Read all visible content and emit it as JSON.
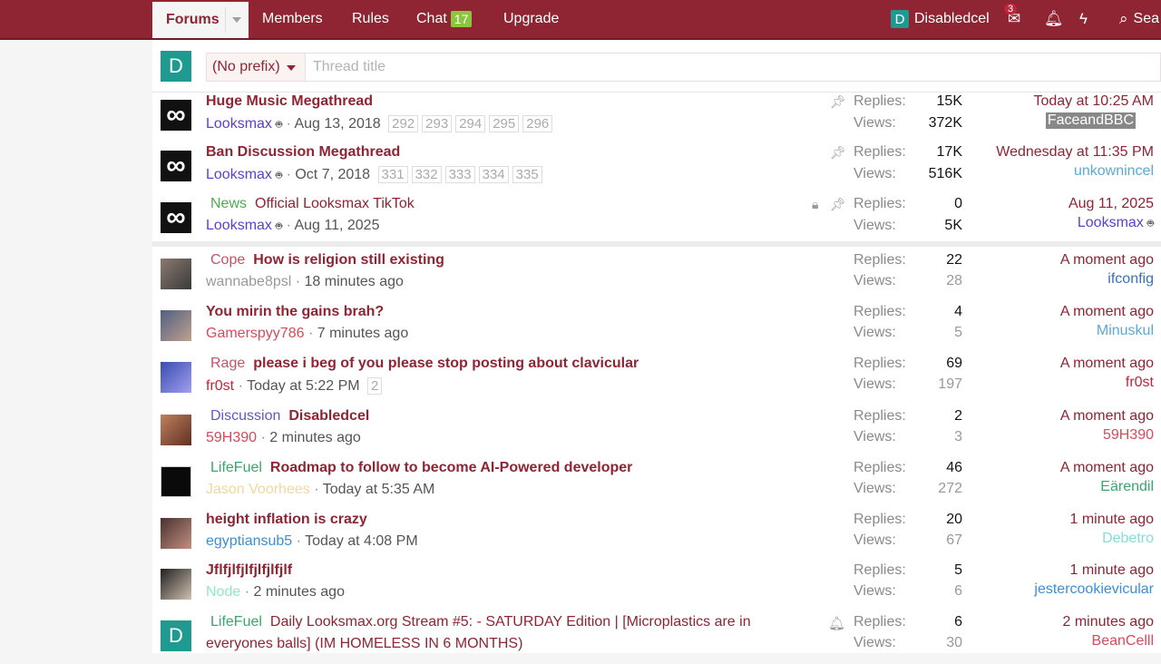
{
  "nav": {
    "forums": "Forums",
    "members": "Members",
    "rules": "Rules",
    "chat": "Chat",
    "chat_count": "17",
    "upgrade": "Upgrade",
    "user_initial": "D",
    "username": "Disabledcel",
    "inbox_count": "3",
    "search": "Sea"
  },
  "composer": {
    "avatar_initial": "D",
    "prefix": "(No prefix)",
    "title_placeholder": "Thread title"
  },
  "sticky_threads": [
    {
      "prefix": "",
      "title": "Huge Music Megathread",
      "author": "Looksmax",
      "date": "Aug 13, 2018",
      "pages": [
        "292",
        "293",
        "294",
        "295",
        "296"
      ],
      "replies_label": "Replies:",
      "replies": "15K",
      "views_label": "Views:",
      "views": "372K",
      "last_time": "Today at 10:25 AM",
      "last_user": "FaceandBBC"
    },
    {
      "prefix": "",
      "title": "Ban Discussion Megathread",
      "author": "Looksmax",
      "date": "Oct 7, 2018",
      "pages": [
        "331",
        "332",
        "333",
        "334",
        "335"
      ],
      "replies_label": "Replies:",
      "replies": "17K",
      "views_label": "Views:",
      "views": "516K",
      "last_time": "Wednesday at 11:35 PM",
      "last_user": "unkownincel"
    },
    {
      "prefix": "News",
      "title": "Official Looksmax TikTok",
      "author": "Looksmax",
      "date": "Aug 11, 2025",
      "pages": [],
      "replies_label": "Replies:",
      "replies": "0",
      "views_label": "Views:",
      "views": "5K",
      "last_time": "Aug 11, 2025",
      "last_user": "Looksmax"
    }
  ],
  "threads": [
    {
      "prefix": "Cope",
      "title": "How is religion still existing",
      "author": "wannabe8psl",
      "date": "18 minutes ago",
      "pages": [],
      "replies": "22",
      "views": "28",
      "last_time": "A moment ago",
      "last_user": "ifconfig"
    },
    {
      "prefix": "",
      "title": "You mirin the gains brah?",
      "author": "Gamerspyy786",
      "date": "7 minutes ago",
      "pages": [],
      "replies": "4",
      "views": "5",
      "last_time": "A moment ago",
      "last_user": "Minuskul"
    },
    {
      "prefix": "Rage",
      "title": "please i beg of you please stop posting about clavicular",
      "author": "fr0st",
      "date": "Today at 5:22 PM",
      "pages": [
        "2"
      ],
      "replies": "69",
      "views": "197",
      "last_time": "A moment ago",
      "last_user": "fr0st"
    },
    {
      "prefix": "Discussion",
      "title": "Disabledcel",
      "author": "59H390",
      "date": "2 minutes ago",
      "pages": [],
      "replies": "2",
      "views": "3",
      "last_time": "A moment ago",
      "last_user": "59H390"
    },
    {
      "prefix": "LifeFuel",
      "title": "Roadmap to follow to become AI-Powered developer",
      "author": "Jason Voorhees",
      "date": "Today at 5:35 AM",
      "pages": [],
      "replies": "46",
      "views": "272",
      "last_time": "A moment ago",
      "last_user": "Eärendil"
    },
    {
      "prefix": "",
      "title": "height inflation is crazy",
      "author": "egyptiansub5",
      "date": "Today at 4:08 PM",
      "pages": [],
      "replies": "20",
      "views": "67",
      "last_time": "1 minute ago",
      "last_user": "Debetro"
    },
    {
      "prefix": "",
      "title": "Jflfjlfjlfjlfjlfjlf",
      "author": "Node",
      "date": "2 minutes ago",
      "pages": [],
      "replies": "5",
      "views": "6",
      "last_time": "1 minute ago",
      "last_user": "jestercookievicular"
    },
    {
      "prefix": "LifeFuel",
      "title": "Daily Looksmax.org Stream #5: - SATURDAY Edition | [Microplastics are in",
      "title2": "everyones balls] (IM HOMELESS IN 6 MONTHS)",
      "author": "",
      "date": "",
      "pages": [],
      "replies": "6",
      "views": "30",
      "last_time": "2 minutes ago",
      "last_user": "BeanCelll"
    }
  ],
  "labels": {
    "replies": "Replies:",
    "views": "Views:"
  },
  "colors": {
    "brand": "#8f2433",
    "teal": "#1e9a90",
    "chat_badge": "#8cc63f"
  }
}
